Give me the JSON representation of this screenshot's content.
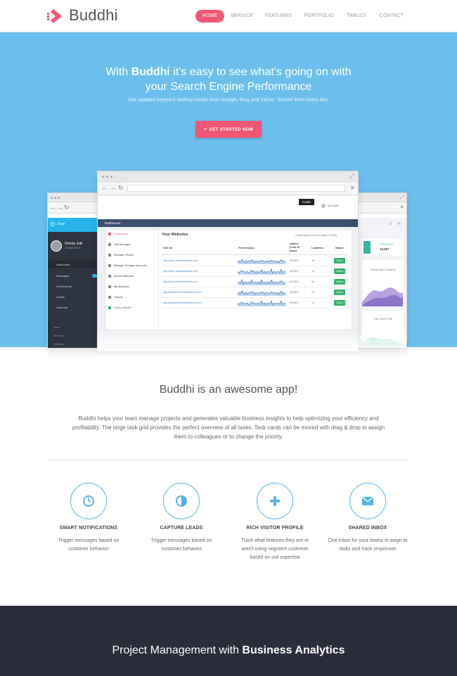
{
  "nav": {
    "brand": "Buddhi",
    "items": [
      "HOME",
      "SERVICE",
      "FEATURES",
      "PORTFOLIO",
      "TABLES",
      "CONTACT"
    ],
    "active_index": 0,
    "accent_color": "#f25675"
  },
  "hero": {
    "title_prefix": "With ",
    "title_brand": "Buddhi",
    "title_line1_rest": " it's easy to see what's going on with",
    "title_line2": "your Search Engine Performance",
    "subtitle": "Get updated keyword ranking results from Google, Bing and Yahoo. Served fresh every day.",
    "cta_label": "GET STARTED NOW",
    "cta_icon": "plus-icon",
    "background": "#6cbfec"
  },
  "mock_center": {
    "guide_label": "Guide",
    "profile_label": "My Profile",
    "dashboard_label": "Dashboard",
    "menu": [
      "Dashboard",
      "Site Manager",
      "Manage cPanel",
      "Manage Storage Accounts",
      "Import Backups",
      "My Backups",
      "Tokens",
      "Clone cPanel"
    ],
    "panel_title": "Your Websites",
    "uptime_label": "Global Uptime (Last 30 days): 97.50%",
    "columns": [
      "Site Url",
      "Performance",
      "Uptime (Last 30 days)",
      "Loadtime",
      "Status"
    ],
    "rows": [
      {
        "url": "http://dev1.bestofwebtools.com",
        "uptime": "90.00%",
        "load": "3s",
        "status": "Online"
      },
      {
        "url": "http://dev2.bestofwebtools.com",
        "uptime": "90.00%",
        "load": "1s",
        "status": "Online"
      },
      {
        "url": "http://dev3.bestofwebtools.com",
        "uptime": "90.00%",
        "load": "3s",
        "status": "Online"
      },
      {
        "url": "http://pixeldev.bestofwebtools.com",
        "uptime": "90.00%",
        "load": "2s",
        "status": "Online"
      },
      {
        "url": "http://pixeldev.bestofwebtools.com",
        "uptime": "90.00%",
        "load": "1s",
        "status": "Online"
      }
    ]
  },
  "mock_left": {
    "brand": "Zeqri",
    "user_name": "Oronto Jolli",
    "user_role": "Creative Pixel",
    "menu": [
      "Dashboard",
      "Messages",
      "UI Elements",
      "Charts",
      "Calendar"
    ],
    "bottom_menu": [
      "User",
      "Security",
      "Settings"
    ]
  },
  "mock_right": {
    "stat_label": "PRODUCTS",
    "stat_value": "19,587",
    "chart1_label": "Monthly Sales & Expense",
    "chart2_label": "Your Chart & Profit",
    "page_number": "0"
  },
  "about": {
    "title": "Buddhi is an awesome app!",
    "body": "Buddhi helps your team manage projects and generates valuable business insights to help optimizing your efficiency and profitability. The large task grid provides the perfect overview of all tasks. Task cards can be moved with drag & drop to assign them to colleagues or to change the priority."
  },
  "features": [
    {
      "icon": "clock-icon",
      "title": "SMART NOTIFICATIONS",
      "desc": "Trigger messages based on customer behavior"
    },
    {
      "icon": "half-circle-icon",
      "title": "CAPTURE LEADS",
      "desc": "Trigger messages based on customer behavior"
    },
    {
      "icon": "plus-icon",
      "title": "RICH VISITOR PROFILE",
      "desc": "Track what features they are or aren't using segment customer based on our expertise"
    },
    {
      "icon": "envelope-icon",
      "title": "SHARED INBOX",
      "desc": "One inbox for your teams to asign to tasks and track responses"
    }
  ],
  "footer_section": {
    "title_prefix": "Project Management with ",
    "title_bold": "Business Analytics",
    "background": "#2b2d3a"
  }
}
